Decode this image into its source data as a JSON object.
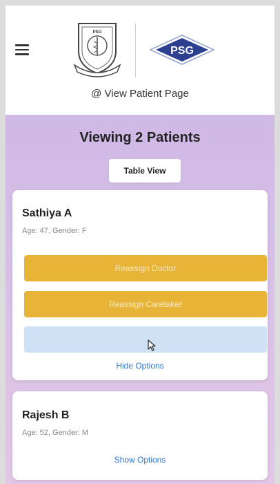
{
  "header": {
    "page_title": "@ View Patient Page",
    "crest_text": "PSG",
    "logo_text": "PSG"
  },
  "main": {
    "title": "Viewing 2 Patients",
    "table_view_label": "Table View"
  },
  "patients": [
    {
      "name": "Sathiya A",
      "meta": "Age: 47, Gender: F",
      "reassign_doctor_label": "Reassign Doctor",
      "reassign_caretaker_label": "Reassign Caretaker",
      "toggle_label": "Hide Options"
    },
    {
      "name": "Rajesh B",
      "meta": "Age: 52, Gender: M",
      "toggle_label": "Show Options"
    }
  ],
  "colors": {
    "accent": "#e8b437",
    "link": "#2f78d2",
    "background": "#c9b4e3"
  }
}
